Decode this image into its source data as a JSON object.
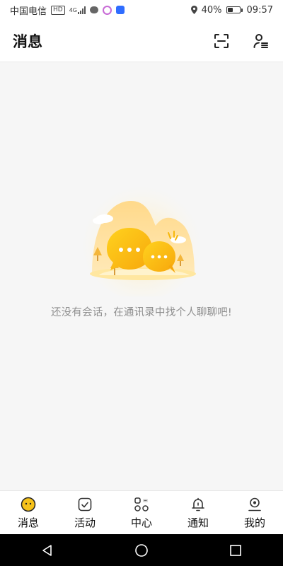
{
  "status_bar": {
    "carrier": "中国电信",
    "network_badge": "HD",
    "network_type": "4G",
    "battery_percent": "40%",
    "battery_level": 0.4,
    "time": "09:57",
    "icons": [
      "hd-icon",
      "signal-icon",
      "message-bubble-icon",
      "app-notification-icon",
      "shield-notification-icon",
      "location-icon",
      "battery-icon"
    ]
  },
  "header": {
    "title": "消息",
    "actions": [
      "scan-icon",
      "contacts-icon"
    ]
  },
  "empty_state": {
    "message": "还没有会话，在通讯录中找个人聊聊吧!"
  },
  "tabs": [
    {
      "label": "消息",
      "icon": "message-face-icon",
      "active": true
    },
    {
      "label": "活动",
      "icon": "activity-check-icon"
    },
    {
      "label": "中心",
      "icon": "center-grid-icon"
    },
    {
      "label": "通知",
      "icon": "bell-icon"
    },
    {
      "label": "我的",
      "icon": "profile-icon"
    }
  ],
  "colors": {
    "accent": "#f6c21a",
    "text_muted": "#8f8f8f",
    "nav_bar": "#000000"
  }
}
